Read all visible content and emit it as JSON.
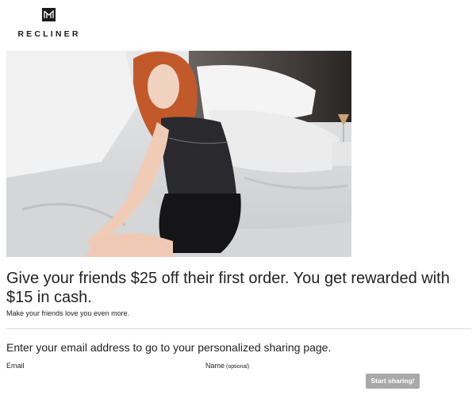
{
  "brand": {
    "name": "RECLINER",
    "logo_icon": "recliner-monogram"
  },
  "hero": {
    "image": "woman-sitting-on-bed-photo"
  },
  "offer": {
    "headline": "Give your friends $25 off their first order. You get rewarded with $15 in cash.",
    "subline": "Make your friends love you even more."
  },
  "form": {
    "prompt": "Enter your email address to go to your personalized sharing page.",
    "email_label": "Email",
    "email_value": "",
    "name_label": "Name",
    "name_optional": "(optional)",
    "name_value": "",
    "submit_label": "Start sharing!"
  },
  "colors": {
    "button_bg": "#a9a9a9",
    "divider": "#dcdcdc",
    "text": "#222222"
  }
}
